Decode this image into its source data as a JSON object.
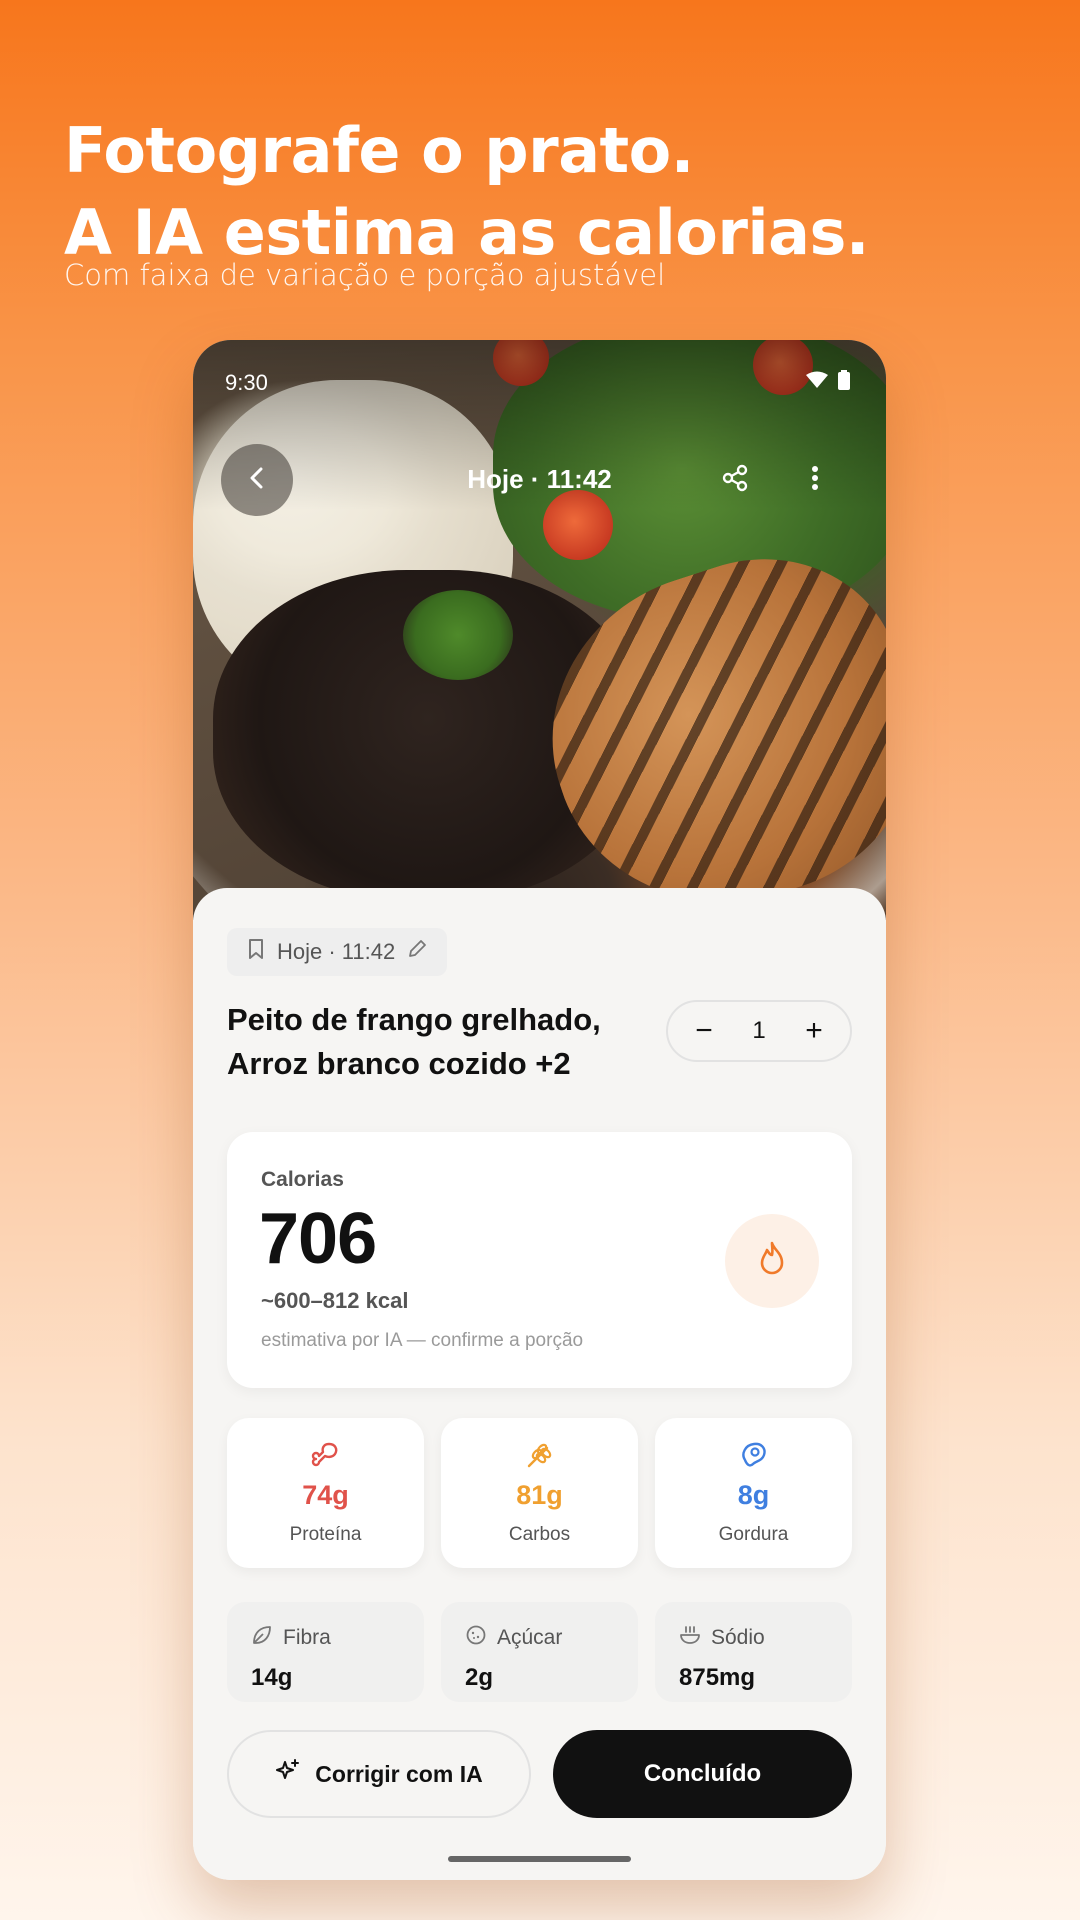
{
  "promo": {
    "headline_line1": "Fotografe o prato.",
    "headline_line2": "A IA estima as calorias.",
    "subheadline": "Com faixa de variação e porção ajustável"
  },
  "status_bar": {
    "time": "9:30",
    "icons": [
      "wifi-icon",
      "battery-icon"
    ]
  },
  "top_bar": {
    "title": "Hoje · 11:42",
    "back_icon": "chevron-left-icon",
    "share_icon": "share-icon",
    "more_icon": "more-vertical-icon"
  },
  "meal": {
    "meta_chip": "Hoje · 11:42",
    "title_line1": "Peito de frango grelhado,",
    "title_line2": "Arroz branco cozido +2",
    "portion": {
      "decrement": "−",
      "value": "1",
      "increment": "+"
    }
  },
  "calories": {
    "label": "Calorias",
    "value": "706",
    "range": "~600–812 kcal",
    "note": "estimativa por IA — confirme a porção",
    "icon": "flame-icon"
  },
  "macros": [
    {
      "value": "74g",
      "label": "Proteína",
      "color": "#e0524a",
      "icon": "drumstick-icon"
    },
    {
      "value": "81g",
      "label": "Carbos",
      "color": "#f0a030",
      "icon": "wheat-icon"
    },
    {
      "value": "8g",
      "label": "Gordura",
      "color": "#3f7fe0",
      "icon": "beef-icon"
    }
  ],
  "micros": [
    {
      "label": "Fibra",
      "value": "14g",
      "icon": "leaf-icon"
    },
    {
      "label": "Açúcar",
      "value": "2g",
      "icon": "cookie-icon"
    },
    {
      "label": "Sódio",
      "value": "875mg",
      "icon": "soup-icon"
    }
  ],
  "actions": {
    "fix_with_ai": "Corrigir com IA",
    "done": "Concluído"
  },
  "colors": {
    "brand_orange": "#f7761c",
    "flame": "#f07a2a"
  }
}
